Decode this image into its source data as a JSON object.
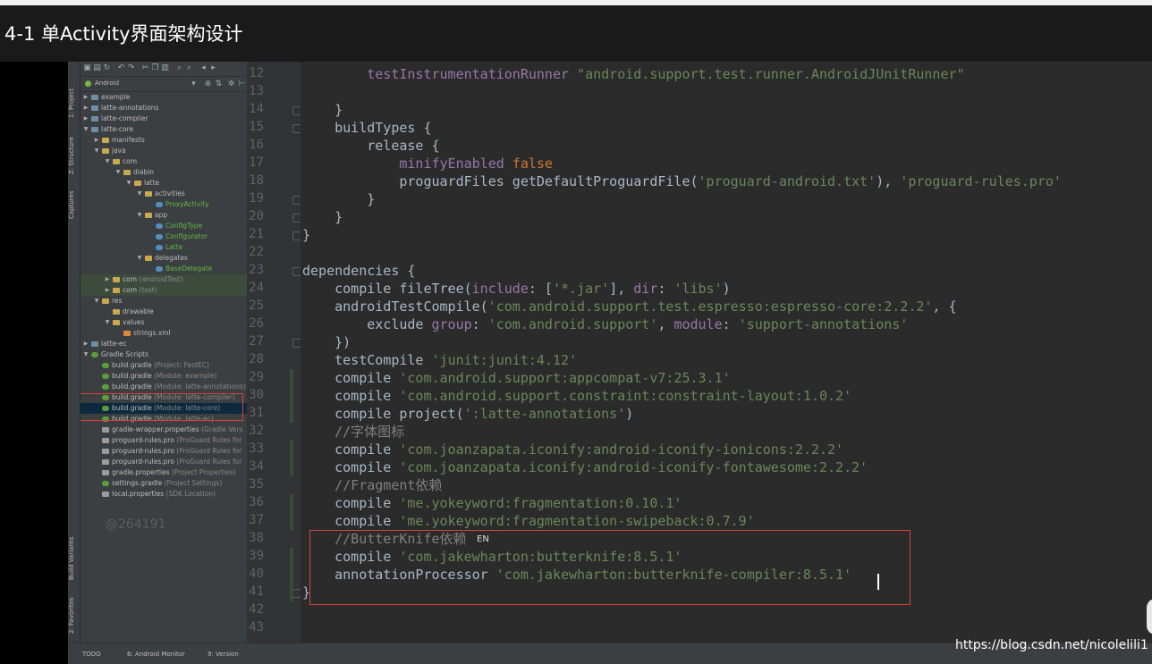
{
  "page_title": "4-1 单Activity界面架构设计",
  "project_panel": {
    "view_mode": "Android",
    "side_tabs": [
      "1: Project",
      "Z: Structure",
      "Captures",
      "Build Variants",
      "2: Favorites"
    ],
    "tree": [
      {
        "label": "example",
        "sub": "",
        "depth": 0,
        "arrow": "▶",
        "icon": "modf"
      },
      {
        "label": "latte-annotations",
        "sub": "",
        "depth": 0,
        "arrow": "▶",
        "icon": "modf"
      },
      {
        "label": "latte-compiler",
        "sub": "",
        "depth": 0,
        "arrow": "▶",
        "icon": "modf"
      },
      {
        "label": "latte-core",
        "sub": "",
        "depth": 0,
        "arrow": "▼",
        "icon": "modf"
      },
      {
        "label": "manifests",
        "sub": "",
        "depth": 1,
        "arrow": "▶",
        "icon": "fold"
      },
      {
        "label": "java",
        "sub": "",
        "depth": 1,
        "arrow": "▼",
        "icon": "fold"
      },
      {
        "label": "com",
        "sub": "",
        "depth": 2,
        "arrow": "▼",
        "icon": "fold"
      },
      {
        "label": "diabin",
        "sub": "",
        "depth": 3,
        "arrow": "▼",
        "icon": "fold"
      },
      {
        "label": "latte",
        "sub": "",
        "depth": 4,
        "arrow": "▼",
        "icon": "fold"
      },
      {
        "label": "activities",
        "sub": "",
        "depth": 5,
        "arrow": "▼",
        "icon": "fold"
      },
      {
        "label": "ProxyActivity",
        "sub": "",
        "depth": 6,
        "arrow": "",
        "icon": "cls",
        "color": "#62b543"
      },
      {
        "label": "app",
        "sub": "",
        "depth": 5,
        "arrow": "▼",
        "icon": "fold"
      },
      {
        "label": "ConfigType",
        "sub": "",
        "depth": 6,
        "arrow": "",
        "icon": "cls",
        "color": "#62b543"
      },
      {
        "label": "Configurator",
        "sub": "",
        "depth": 6,
        "arrow": "",
        "icon": "cls",
        "color": "#62b543"
      },
      {
        "label": "Latte",
        "sub": "",
        "depth": 6,
        "arrow": "",
        "icon": "cls",
        "color": "#62b543"
      },
      {
        "label": "delegates",
        "sub": "",
        "depth": 5,
        "arrow": "▼",
        "icon": "fold"
      },
      {
        "label": "BaseDelegate",
        "sub": "",
        "depth": 6,
        "arrow": "",
        "icon": "cls",
        "color": "#62b543"
      },
      {
        "label": "com",
        "sub": " (androidTest)",
        "depth": 2,
        "arrow": "▶",
        "icon": "fold",
        "bg": "#3d4b3d"
      },
      {
        "label": "com",
        "sub": " (test)",
        "depth": 2,
        "arrow": "▶",
        "icon": "fold",
        "bg": "#3d4b3d"
      },
      {
        "label": "res",
        "sub": "",
        "depth": 1,
        "arrow": "▼",
        "icon": "fold"
      },
      {
        "label": "drawable",
        "sub": "",
        "depth": 2,
        "arrow": "",
        "icon": "fold"
      },
      {
        "label": "values",
        "sub": "",
        "depth": 2,
        "arrow": "▼",
        "icon": "fold"
      },
      {
        "label": "strings.xml",
        "sub": "",
        "depth": 3,
        "arrow": "",
        "icon": "xml"
      },
      {
        "label": "latte-ec",
        "sub": "",
        "depth": 0,
        "arrow": "▶",
        "icon": "modf"
      },
      {
        "label": "Gradle Scripts",
        "sub": "",
        "depth": 0,
        "arrow": "▼",
        "icon": "grd"
      },
      {
        "label": "build.gradle",
        "sub": " (Project: FestEC)",
        "depth": 1,
        "arrow": "",
        "icon": "grd"
      },
      {
        "label": "build.gradle",
        "sub": " (Module: example)",
        "depth": 1,
        "arrow": "",
        "icon": "grd"
      },
      {
        "label": "build.gradle",
        "sub": " (Module: latte-annotations)",
        "depth": 1,
        "arrow": "",
        "icon": "grd"
      },
      {
        "label": "build.gradle",
        "sub": " (Module: latte-compiler)",
        "depth": 1,
        "arrow": "",
        "icon": "grd"
      },
      {
        "label": "build.gradle",
        "sub": " (Module: latte-core)",
        "depth": 1,
        "arrow": "",
        "icon": "grd",
        "selected": true
      },
      {
        "label": "build.gradle",
        "sub": " (Module: latte-ec)",
        "depth": 1,
        "arrow": "",
        "icon": "grd"
      },
      {
        "label": "gradle-wrapper.properties",
        "sub": " (Gradle Vers",
        "depth": 1,
        "arrow": "",
        "icon": "fil"
      },
      {
        "label": "proguard-rules.pro",
        "sub": " (ProGuard Rules for",
        "depth": 1,
        "arrow": "",
        "icon": "fil"
      },
      {
        "label": "proguard-rules.pro",
        "sub": " (ProGuard Rules for",
        "depth": 1,
        "arrow": "",
        "icon": "fil"
      },
      {
        "label": "proguard-rules.pro",
        "sub": " (ProGuard Rules for",
        "depth": 1,
        "arrow": "",
        "icon": "fil"
      },
      {
        "label": "gradle.properties",
        "sub": " (Project Properties)",
        "depth": 1,
        "arrow": "",
        "icon": "fil"
      },
      {
        "label": "settings.gradle",
        "sub": " (Project Settings)",
        "depth": 1,
        "arrow": "",
        "icon": "grd"
      },
      {
        "label": "local.properties",
        "sub": " (SDK Location)",
        "depth": 1,
        "arrow": "",
        "icon": "fil"
      }
    ],
    "watermark": "@264191"
  },
  "editor": {
    "lines": [
      {
        "n": "12",
        "tokens": [
          {
            "t": "        "
          },
          {
            "t": "testInstrumentationRunner ",
            "c": "p"
          },
          {
            "t": "\"android.support.test.runner.AndroidJUnitRunner\"",
            "c": "s"
          }
        ]
      },
      {
        "n": "13",
        "tokens": []
      },
      {
        "n": "14",
        "tokens": [
          {
            "t": "    }"
          }
        ]
      },
      {
        "n": "15",
        "tokens": [
          {
            "t": "    buildTypes {"
          }
        ]
      },
      {
        "n": "16",
        "tokens": [
          {
            "t": "        release {"
          }
        ]
      },
      {
        "n": "17",
        "tokens": [
          {
            "t": "            "
          },
          {
            "t": "minifyEnabled ",
            "c": "p"
          },
          {
            "t": "false",
            "c": "k"
          }
        ]
      },
      {
        "n": "18",
        "tokens": [
          {
            "t": "            proguardFiles getDefaultProguardFile("
          },
          {
            "t": "'proguard-android.txt'",
            "c": "s"
          },
          {
            "t": "), "
          },
          {
            "t": "'proguard-rules.pro'",
            "c": "s"
          }
        ]
      },
      {
        "n": "19",
        "tokens": [
          {
            "t": "        }"
          }
        ]
      },
      {
        "n": "20",
        "tokens": [
          {
            "t": "    }"
          }
        ]
      },
      {
        "n": "21",
        "tokens": [
          {
            "t": "}"
          }
        ]
      },
      {
        "n": "22",
        "tokens": []
      },
      {
        "n": "23",
        "tokens": [
          {
            "t": "dependencies {"
          }
        ]
      },
      {
        "n": "24",
        "tokens": [
          {
            "t": "    compile fileTree("
          },
          {
            "t": "include",
            "c": "p"
          },
          {
            "t": ": ["
          },
          {
            "t": "'*.jar'",
            "c": "s"
          },
          {
            "t": "], "
          },
          {
            "t": "dir",
            "c": "p"
          },
          {
            "t": ": "
          },
          {
            "t": "'libs'",
            "c": "s"
          },
          {
            "t": ")"
          }
        ]
      },
      {
        "n": "25",
        "tokens": [
          {
            "t": "    androidTestCompile("
          },
          {
            "t": "'com.android.support.test.espresso:espresso-core:2.2.2'",
            "c": "s"
          },
          {
            "t": ", {"
          }
        ]
      },
      {
        "n": "26",
        "tokens": [
          {
            "t": "        exclude "
          },
          {
            "t": "group",
            "c": "p"
          },
          {
            "t": ": "
          },
          {
            "t": "'com.android.support'",
            "c": "s"
          },
          {
            "t": ", "
          },
          {
            "t": "module",
            "c": "p"
          },
          {
            "t": ": "
          },
          {
            "t": "'support-annotations'",
            "c": "s"
          }
        ]
      },
      {
        "n": "27",
        "tokens": [
          {
            "t": "    })"
          }
        ]
      },
      {
        "n": "28",
        "tokens": [
          {
            "t": "    testCompile "
          },
          {
            "t": "'junit:junit:4.12'",
            "c": "s"
          }
        ]
      },
      {
        "n": "29",
        "tokens": [
          {
            "t": "    compile "
          },
          {
            "t": "'com.android.support:appcompat-v7:25.3.1'",
            "c": "s"
          }
        ]
      },
      {
        "n": "30",
        "tokens": [
          {
            "t": "    compile "
          },
          {
            "t": "'com.android.support.constraint:constraint-layout:1.0.2'",
            "c": "s"
          }
        ]
      },
      {
        "n": "31",
        "tokens": [
          {
            "t": "    compile project("
          },
          {
            "t": "':latte-annotations'",
            "c": "s"
          },
          {
            "t": ")"
          }
        ]
      },
      {
        "n": "32",
        "tokens": [
          {
            "t": "    //字体图标",
            "c": "c"
          }
        ]
      },
      {
        "n": "33",
        "tokens": [
          {
            "t": "    compile "
          },
          {
            "t": "'com.joanzapata.iconify:android-iconify-ionicons:2.2.2'",
            "c": "s"
          }
        ]
      },
      {
        "n": "34",
        "tokens": [
          {
            "t": "    compile "
          },
          {
            "t": "'com.joanzapata.iconify:android-iconify-fontawesome:2.2.2'",
            "c": "s"
          }
        ]
      },
      {
        "n": "35",
        "tokens": [
          {
            "t": "    //Fragment依赖",
            "c": "c"
          }
        ]
      },
      {
        "n": "36",
        "tokens": [
          {
            "t": "    compile "
          },
          {
            "t": "'me.yokeyword:fragmentation:0.10.1'",
            "c": "s"
          }
        ]
      },
      {
        "n": "37",
        "tokens": [
          {
            "t": "    compile "
          },
          {
            "t": "'me.yokeyword:fragmentation-swipeback:0.7.9'",
            "c": "s"
          }
        ]
      },
      {
        "n": "38",
        "tokens": [
          {
            "t": "    //ButterKnife依赖",
            "c": "c"
          }
        ]
      },
      {
        "n": "39",
        "tokens": [
          {
            "t": "    compile "
          },
          {
            "t": "'com.jakewharton:butterknife:8.5.1'",
            "c": "s"
          }
        ]
      },
      {
        "n": "40",
        "tokens": [
          {
            "t": "    annotationProcessor "
          },
          {
            "t": "'com.jakewharton:butterknife-compiler:8.5.1'",
            "c": "s"
          }
        ]
      },
      {
        "n": "41",
        "tokens": [
          {
            "t": "}"
          }
        ]
      },
      {
        "n": "42",
        "tokens": []
      },
      {
        "n": "43",
        "tokens": []
      }
    ],
    "ime_indicator": "EN"
  },
  "bottom_bar": {
    "items": [
      "TODO",
      "6: Android Monitor",
      "9: Version"
    ]
  },
  "url_watermark": "https://blog.csdn.net/nicolelili1"
}
